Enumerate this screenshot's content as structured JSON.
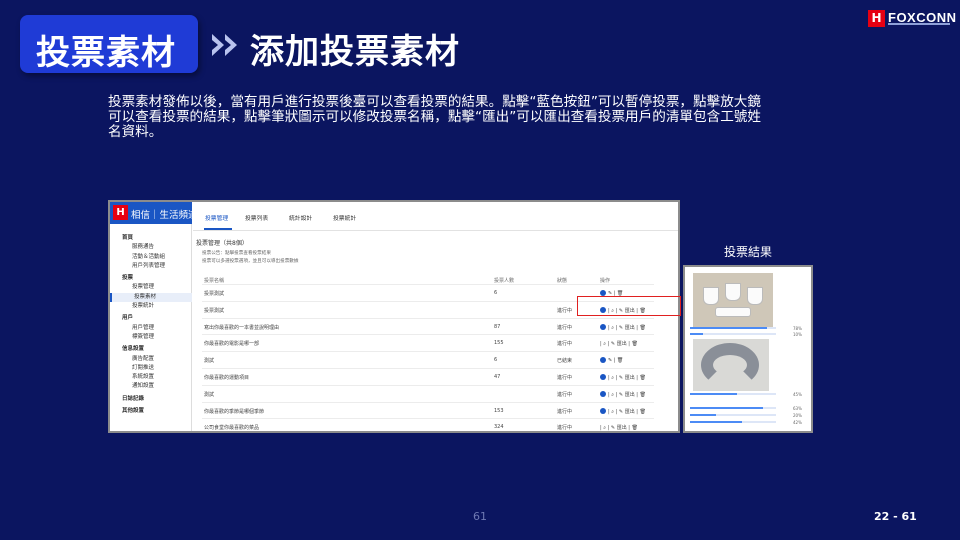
{
  "header": {
    "title": "投票素材",
    "subtitle": "添加投票素材",
    "logo_text": "FOXCONN",
    "logo_mark": "H"
  },
  "description": "投票素材發佈以後，當有用戶進行投票後臺可以查看投票的結果。點擊“藍色按鈕”可以暫停投票，點擊放大鏡可以查看投票的結果，點擊筆狀圖示可以修改投票名稱，點擊“匯出”可以匯出查看投票用戶的清單包含工號姓名資料。",
  "app": {
    "logo_mark": "H",
    "brand": "相信｜生活頻道",
    "tabs": [
      "投票管理",
      "投票列表",
      "統計設計",
      "投票統計"
    ],
    "sidebar": [
      {
        "label": "首頁",
        "group": true
      },
      {
        "label": "服務通告",
        "group": false
      },
      {
        "label": "活動＆活動組",
        "group": false
      },
      {
        "label": "用戶列表管理",
        "group": false
      },
      {
        "label": "投票",
        "group": true
      },
      {
        "label": "投票管理",
        "group": false
      },
      {
        "label": "投票素材",
        "group": false,
        "active": true
      },
      {
        "label": "投票統計",
        "group": false
      },
      {
        "label": "用戶",
        "group": true
      },
      {
        "label": "用戶管理",
        "group": false
      },
      {
        "label": "標簽管理",
        "group": false
      },
      {
        "label": "信息設置",
        "group": true
      },
      {
        "label": "廣告配置",
        "group": false
      },
      {
        "label": "訂閱推送",
        "group": false
      },
      {
        "label": "系統設置",
        "group": false
      },
      {
        "label": "通知設置",
        "group": false
      },
      {
        "label": "日誌記錄",
        "group": true
      },
      {
        "label": "其他設置",
        "group": true
      }
    ],
    "panel_title": "投票管理（共8個）",
    "tips": [
      "投票公告：點擊投票查看投票結果",
      "投票可以多選投票選項，並且可以導出投票數據"
    ],
    "table": {
      "headers": [
        "投票名稱",
        "投票人數",
        "狀態",
        "操作"
      ],
      "rows": [
        {
          "name": "投票測試",
          "count": "6",
          "status": "",
          "ops": "✎ | 🗑"
        },
        {
          "name": "投票測試",
          "count": "",
          "status": "進行中",
          "ops": "| ⌕ | ✎ 匯出 | 🗑"
        },
        {
          "name": "寫出你最喜歡的一本書並說明理由",
          "count": "87",
          "status": "進行中",
          "ops": "| ⌕ | ✎ 匯出 | 🗑"
        },
        {
          "name": "你最喜歡的電影是哪一部",
          "count": "155",
          "status": "進行中",
          "ops": "| ⌕ | ✎ 匯出 | 🗑"
        },
        {
          "name": "測試",
          "count": "6",
          "status": "已結束",
          "ops": "✎ | 🗑"
        },
        {
          "name": "你最喜歡的運動項目",
          "count": "47",
          "status": "進行中",
          "ops": "| ⌕ | ✎ 匯出 | 🗑"
        },
        {
          "name": "測試",
          "count": "",
          "status": "進行中",
          "ops": "| ⌕ | ✎ 匯出 | 🗑"
        },
        {
          "name": "你最喜歡的季節是哪個季節",
          "count": "153",
          "status": "進行中",
          "ops": "| ⌕ | ✎ 匯出 | 🗑"
        },
        {
          "name": "公司食堂你最喜歡的菜品",
          "count": "324",
          "status": "進行中",
          "ops": "| ⌕ | ✎ 匯出 | 🗑"
        }
      ]
    }
  },
  "result": {
    "label": "投票結果",
    "bars": [
      {
        "fill": 0.9,
        "value": "78%"
      },
      {
        "fill": 0.15,
        "value": "10%"
      },
      {
        "fill": 0.55,
        "value": "45%"
      },
      {
        "fill": 0.85,
        "value": "63%"
      },
      {
        "fill": 0.3,
        "value": "20%"
      },
      {
        "fill": 0.6,
        "value": "42%"
      }
    ]
  },
  "footer": {
    "page_number": "61",
    "page_ref": "22 - 61"
  },
  "colors": {
    "background": "#0b1560",
    "badge": "#1f3bd6",
    "accent": "#1a56c4",
    "highlight": "#e02020"
  }
}
